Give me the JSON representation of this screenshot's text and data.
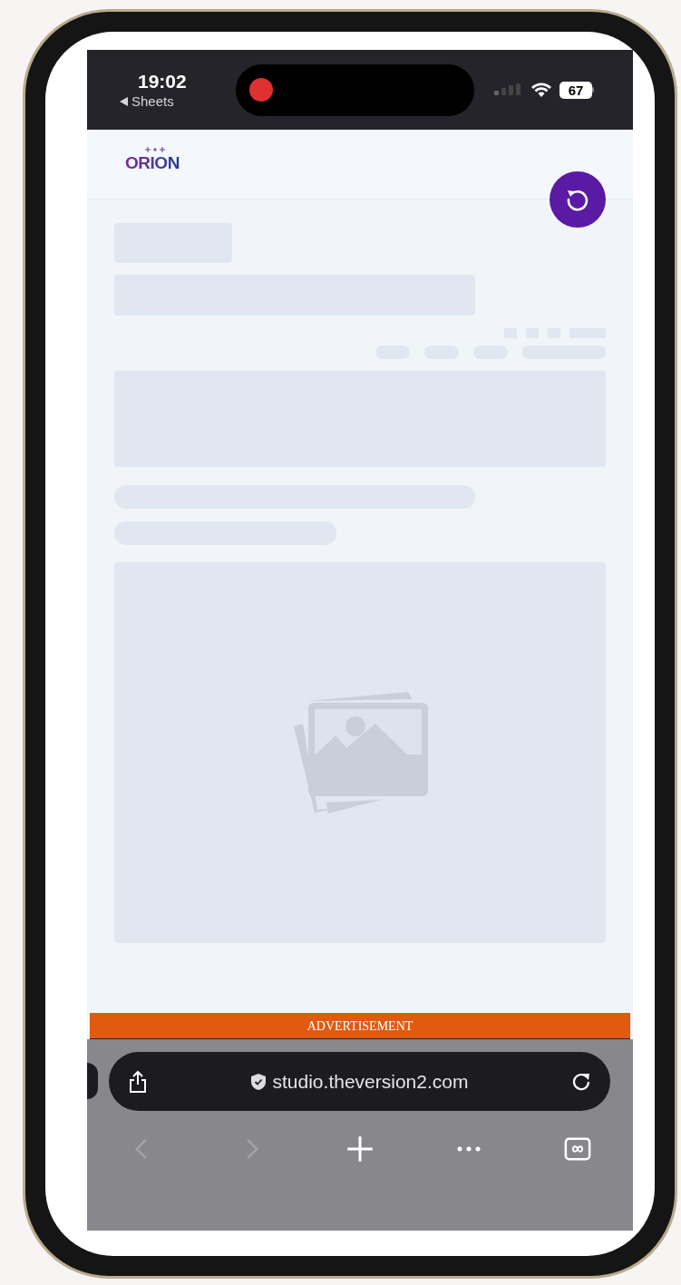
{
  "status_bar": {
    "time": "19:02",
    "back_label": "Sheets",
    "battery": "67",
    "recording": true
  },
  "header": {
    "logo": "ORION"
  },
  "ad_banner": {
    "label": "ADVERTISEMENT"
  },
  "browser": {
    "url": "studio.theversion2.com",
    "nav": [
      {
        "kind": "back",
        "disabled": true
      },
      {
        "kind": "forward",
        "disabled": true
      },
      {
        "kind": "new-tab",
        "disabled": false
      },
      {
        "kind": "more",
        "disabled": false
      },
      {
        "kind": "tabs",
        "disabled": false
      }
    ]
  }
}
